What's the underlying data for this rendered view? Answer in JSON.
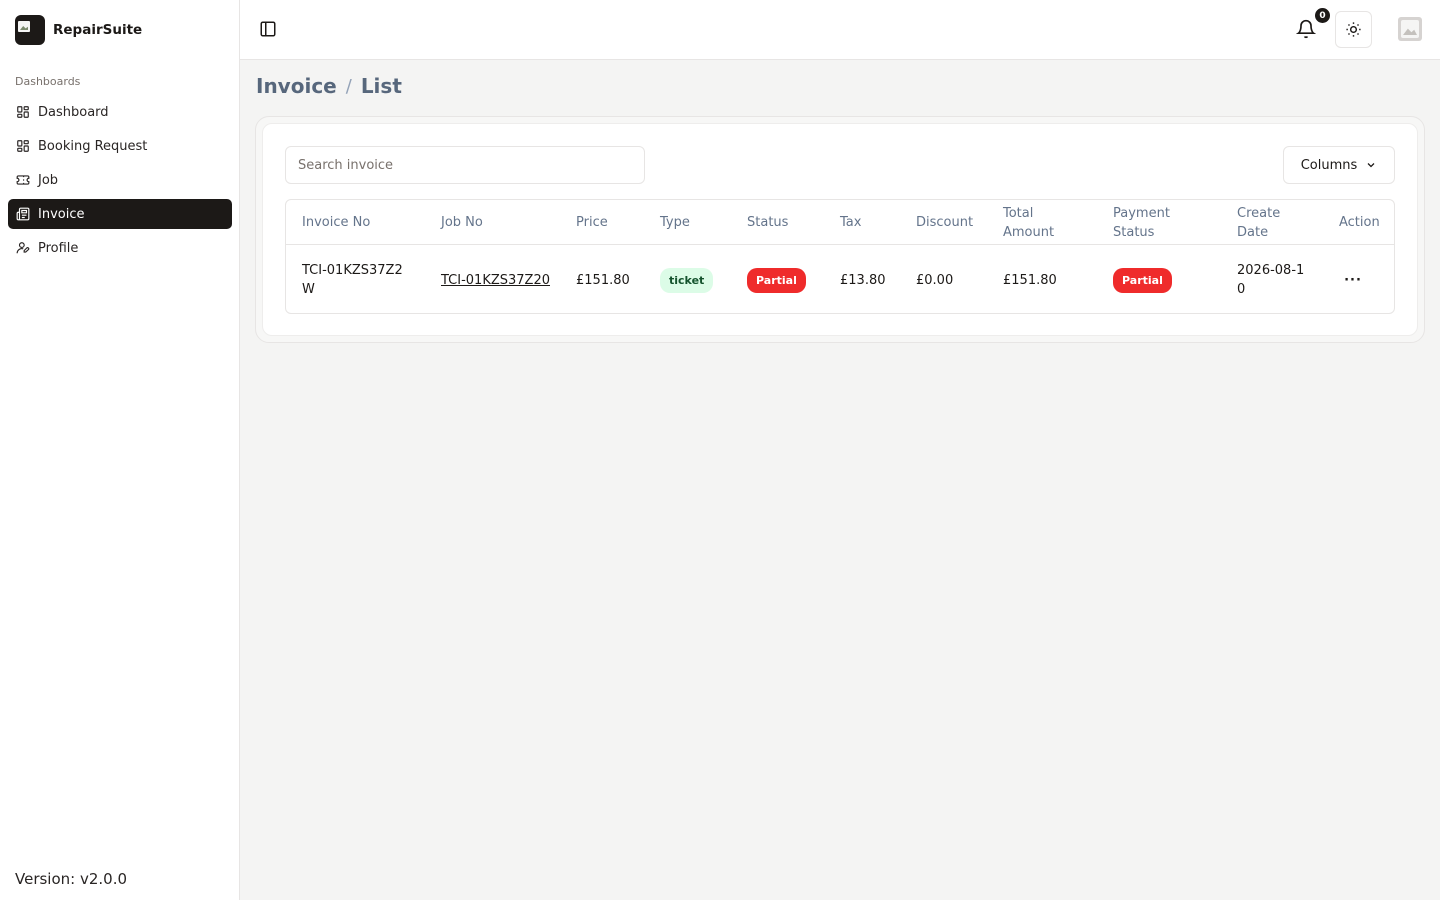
{
  "brand": {
    "name": "RepairSuite"
  },
  "sidebar": {
    "section_label": "Dashboards",
    "items": [
      {
        "label": "Dashboard",
        "icon": "grid-icon",
        "active": false
      },
      {
        "label": "Booking Request",
        "icon": "grid-icon",
        "active": false
      },
      {
        "label": "Job",
        "icon": "ticket-icon",
        "active": false
      },
      {
        "label": "Invoice",
        "icon": "newspaper-icon",
        "active": true
      },
      {
        "label": "Profile",
        "icon": "user-edit-icon",
        "active": false
      }
    ],
    "version": "Version: v2.0.0"
  },
  "header": {
    "notification_count": "0"
  },
  "breadcrumb": {
    "section": "Invoice",
    "separator": "/",
    "page": "List"
  },
  "toolbar": {
    "search_placeholder": "Search invoice",
    "columns_label": "Columns"
  },
  "table": {
    "headers": {
      "invoice_no": "Invoice No",
      "job_no": "Job No",
      "price": "Price",
      "type": "Type",
      "status": "Status",
      "tax": "Tax",
      "discount": "Discount",
      "total_amount": "Total Amount",
      "payment_status": "Payment Status",
      "create_date": "Create Date",
      "action": "Action"
    },
    "rows": [
      {
        "invoice_no": "TCI-01KZS37Z2W",
        "job_no": "TCI-01KZS37Z20",
        "price": "£151.80",
        "type": "ticket",
        "status": "Partial",
        "tax": "£13.80",
        "discount": "£0.00",
        "total_amount": "£151.80",
        "payment_status": "Partial",
        "create_date": "2026-08-10",
        "action": "···"
      }
    ]
  },
  "colors": {
    "accent": "#1c1917",
    "danger": "#ef2b2b",
    "success_bg": "#dcfce7",
    "breadcrumb": "#57677c"
  }
}
